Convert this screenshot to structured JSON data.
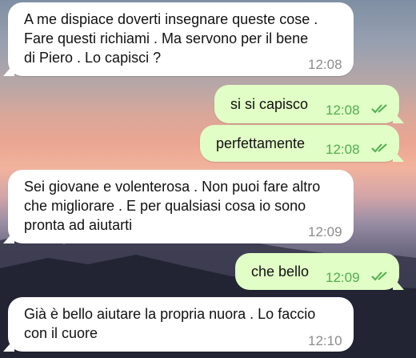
{
  "colors": {
    "incoming_bubble": "#ffffff",
    "outgoing_bubble": "#e1fec6",
    "read_ticks": "#4fae4e"
  },
  "messages": [
    {
      "direction": "incoming",
      "text": "A me dispiace doverti insegnare queste cose .\nFare questi richiami . Ma servono per il bene\ndi Piero . Lo capisci ?",
      "time": "12:08"
    },
    {
      "direction": "outgoing",
      "text": "si si capisco",
      "time": "12:08",
      "status": "read-double-check-icon"
    },
    {
      "direction": "outgoing",
      "text": "perfettamente",
      "time": "12:08",
      "status": "read-double-check-icon"
    },
    {
      "direction": "incoming",
      "text": "Sei giovane e volenterosa . Non puoi fare altro\nche migliorare . E per qualsiasi cosa io sono\npronta ad aiutarti",
      "time": "12:09"
    },
    {
      "direction": "outgoing",
      "text": "che bello",
      "time": "12:09",
      "status": "read-double-check-icon"
    },
    {
      "direction": "incoming",
      "text": "Già è bello aiutare la propria nuora . Lo faccio\ncon il cuore",
      "time": "12:10"
    }
  ]
}
